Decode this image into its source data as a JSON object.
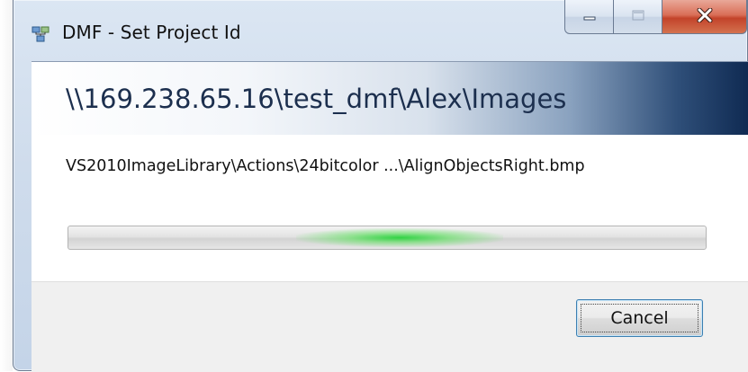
{
  "window": {
    "title": "DMF - Set Project Id",
    "app_icon": "network-dmf-icon",
    "caption_buttons": {
      "minimize_icon": "minimize-icon",
      "maximize_icon": "maximize-icon",
      "close_icon": "close-icon"
    }
  },
  "header": {
    "path": "\\\\169.238.65.16\\test_dmf\\Alex\\Images"
  },
  "status": {
    "current_file": "VS2010ImageLibrary\\Actions\\24bitcolor ...\\AlignObjectsRight.bmp"
  },
  "progress": {
    "mode": "indeterminate",
    "glow_position": 0.52
  },
  "footer": {
    "cancel_label": "Cancel"
  },
  "colors": {
    "progress_glow": "#28d23c",
    "close_button": "#c3432a",
    "header_dark": "#0f2a52"
  }
}
